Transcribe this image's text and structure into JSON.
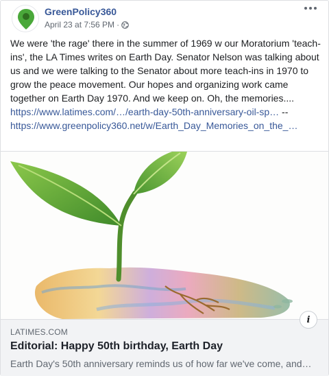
{
  "post": {
    "page_name": "GreenPolicy360",
    "date": "April 23 at 7:56 PM",
    "dot": "·",
    "privacy_icon": "globe-icon",
    "more_icon": "more-options-icon",
    "text": "We were 'the rage' there in the summer of 1969 w our Moratorium 'teach-ins', the LA Times writes on Earth Day. Senator Nelson was talking about us and we were talking to the Senator about more teach-ins in 1970 to grow the peace movement. Our hopes and organizing work came together on Earth Day 1970. And we keep on. Oh, the memories....",
    "link1": "https://www.latimes.com/…/earth-day-50th-anniversary-oil-sp…",
    "separator": "--",
    "link2": "https://www.greenpolicy360.net/w/Earth_Day_Memories_on_the_…"
  },
  "link_preview": {
    "domain": "LATIMES.COM",
    "headline": "Editorial: Happy 50th birthday, Earth Day",
    "description": "Earth Day's 50th anniversary reminds us of how far we've come, and…",
    "info_icon": "i",
    "image_icon": "seedling-illustration"
  },
  "colors": {
    "link": "#385898",
    "text": "#1c1e21",
    "muted": "#606770",
    "leaf": "#5da133",
    "pin": "#4aa83a"
  }
}
